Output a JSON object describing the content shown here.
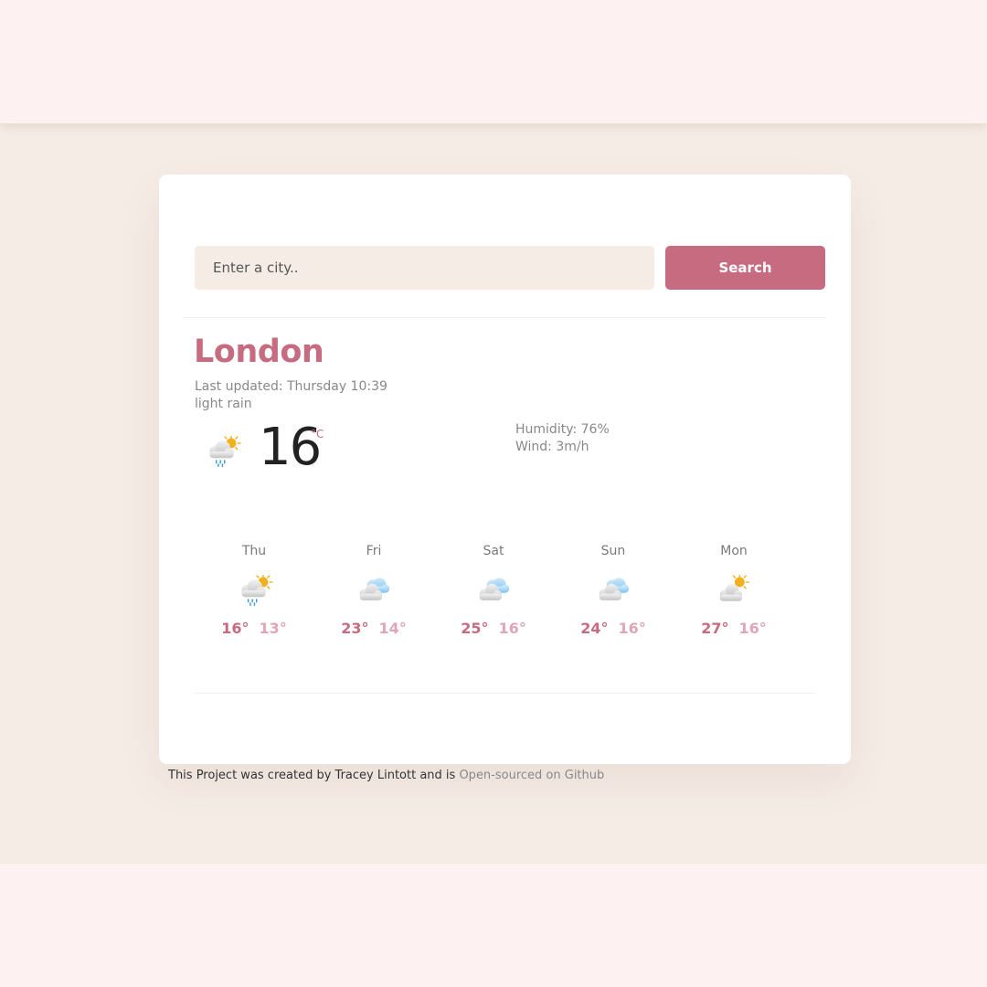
{
  "search": {
    "placeholder": "Enter a city..",
    "button_label": "Search"
  },
  "current": {
    "city": "London",
    "updated_label": "Last updated:",
    "updated_time": "Thursday 10:39",
    "description": "light rain",
    "temperature": "16",
    "unit": "°C",
    "icon": "rain-sun-cloud-icon",
    "humidity_label": "Humidity:",
    "humidity_value": "76%",
    "wind_label": "Wind:",
    "wind_value": "3m/h"
  },
  "forecast": [
    {
      "day": "Thu",
      "max": "16°",
      "min": "13°",
      "icon": "rain-sun-cloud-icon"
    },
    {
      "day": "Fri",
      "max": "23°",
      "min": "14°",
      "icon": "clouds-icon"
    },
    {
      "day": "Sat",
      "max": "25°",
      "min": "16°",
      "icon": "clouds-icon"
    },
    {
      "day": "Sun",
      "max": "24°",
      "min": "16°",
      "icon": "clouds-icon"
    },
    {
      "day": "Mon",
      "max": "27°",
      "min": "16°",
      "icon": "sun-cloud-icon"
    }
  ],
  "footer": {
    "text": "This Project was created by Tracey Lintott and is",
    "link_text": "Open-sourced on Github"
  },
  "colors": {
    "accent": "#c76b80",
    "accent_light": "#e0a6b4",
    "page_background": "#f5ece5",
    "band_background": "#fdf2f1",
    "card_background": "#ffffff"
  }
}
